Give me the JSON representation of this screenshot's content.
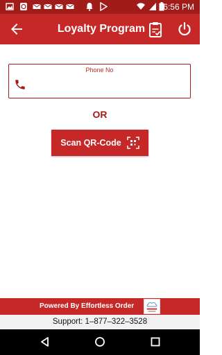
{
  "status_bar": {
    "time": "6:56 PM",
    "notification_icons": [
      "image-icon",
      "whatsapp-icon",
      "mail-icon",
      "mail-icon",
      "mail-icon",
      "mail-icon",
      "notification-bell-icon",
      "play-store-icon"
    ],
    "system_icons": [
      "wifi-icon",
      "signal-icon",
      "battery-icon"
    ]
  },
  "app_bar": {
    "title": "Loyalty Program",
    "back_icon": "arrow-back-icon",
    "clipboard_icon": "clipboard-check-icon",
    "power_icon": "power-icon"
  },
  "phone_field": {
    "label": "Phone No",
    "value": "",
    "icon": "phone-icon"
  },
  "or_text": "OR",
  "scan_button": {
    "label": "Scan QR-Code",
    "icon": "qr-scan-icon"
  },
  "footer": {
    "powered_by": "Powered By Effortless Order",
    "support": "Support: 1–877–322–3528"
  },
  "nav_bar": [
    "back-triangle-icon",
    "home-circle-icon",
    "recents-square-icon"
  ],
  "colors": {
    "primary": "#c62828",
    "status_bar": "#a01c19",
    "background": "#ffffff"
  }
}
